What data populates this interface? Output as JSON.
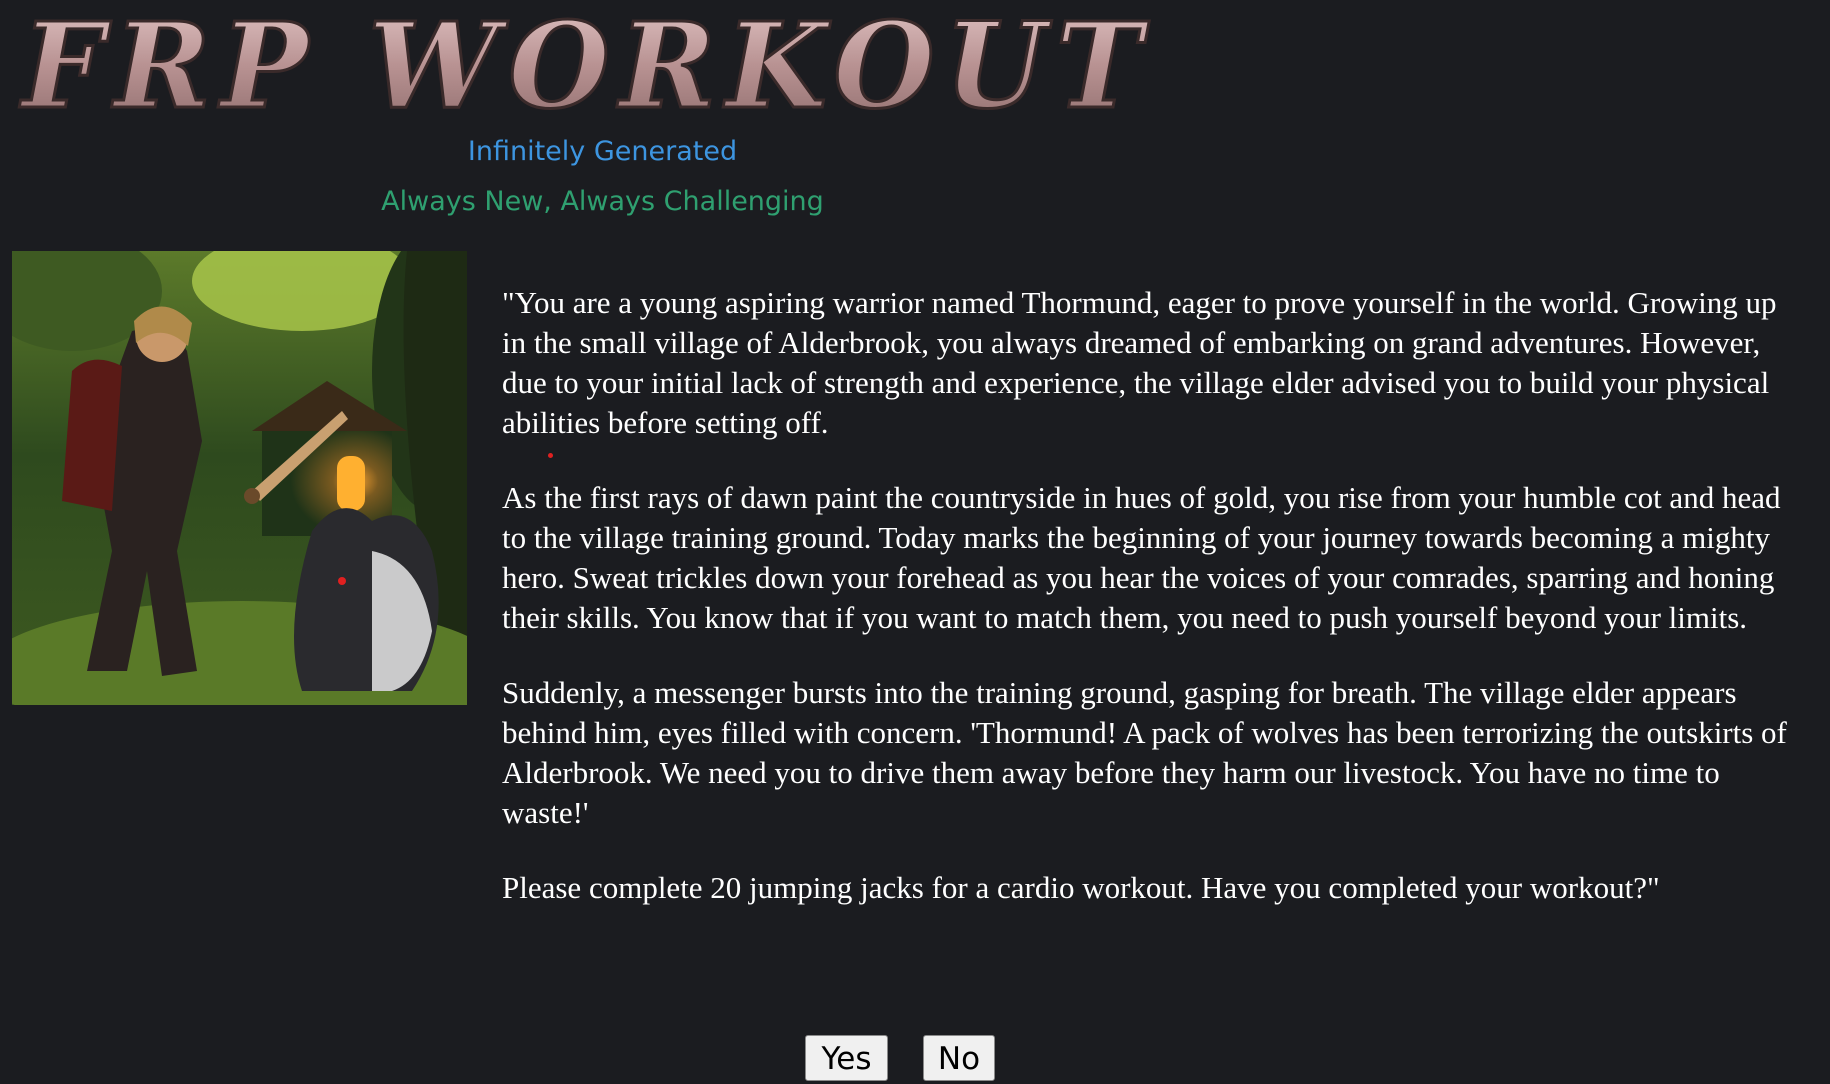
{
  "header": {
    "logo_text": "FRP WORKOUT",
    "tagline_primary": "Infinitely Generated",
    "tagline_secondary": "Always New, Always Challenging"
  },
  "hero_image": {
    "description_icon": "warrior-with-wolf-illustration"
  },
  "story": {
    "paragraphs": [
      "\"You are a young aspiring warrior named Thormund, eager to prove yourself in the world. Growing up in the small village of Alderbrook, you always dreamed of embarking on grand adventures. However, due to your initial lack of strength and experience, the village elder advised you to build your physical abilities before setting off.",
      "As the first rays of dawn paint the countryside in hues of gold, you rise from your humble cot and head to the village training ground. Today marks the beginning of your journey towards becoming a mighty hero. Sweat trickles down your forehead as you hear the voices of your comrades, sparring and honing their skills. You know that if you want to match them, you need to push yourself beyond your limits.",
      "Suddenly, a messenger bursts into the training ground, gasping for breath. The village elder appears behind him, eyes filled with concern. 'Thormund! A pack of wolves has been terrorizing the outskirts of Alderbrook. We need you to drive them away before they harm our livestock. You have no time to waste!'",
      "Please complete 20 jumping jacks for a cardio workout. Have you completed your workout?\""
    ]
  },
  "actions": {
    "yes_label": "Yes",
    "no_label": "No"
  },
  "colors": {
    "background": "#1b1c20",
    "tagline_primary": "#3d95e0",
    "tagline_secondary": "#2fa070",
    "logo_stone": "#c9a3a3"
  }
}
